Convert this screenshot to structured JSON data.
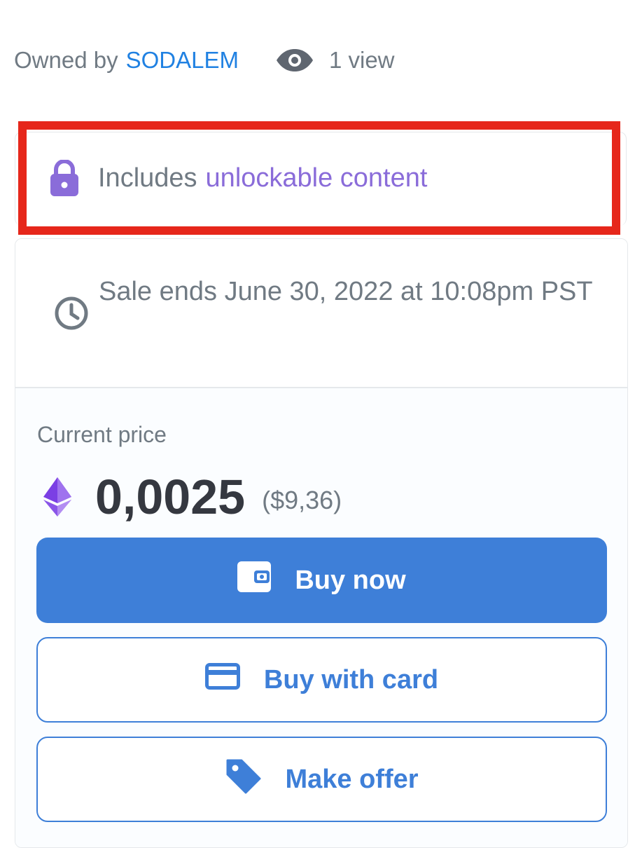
{
  "owner": {
    "prefix": "Owned by",
    "name": "SODALEM",
    "views": "1 view"
  },
  "unlockable": {
    "prefix": "Includes",
    "link": "unlockable content"
  },
  "sale": {
    "ends_text": "Sale ends June 30, 2022 at 10:08pm PST"
  },
  "price": {
    "label": "Current price",
    "value": "0,0025",
    "usd": "($9,36)"
  },
  "buttons": {
    "buy_now": "Buy now",
    "buy_with_card": "Buy with card",
    "make_offer": "Make offer"
  },
  "icons": {
    "eye": "eye-icon",
    "lock": "lock-icon",
    "clock": "clock-icon",
    "eth": "ethereum-icon",
    "wallet": "wallet-icon",
    "card": "credit-card-icon",
    "tag": "tag-icon"
  },
  "colors": {
    "accent": "#3e7fd8",
    "link": "#2081e2",
    "purple": "#8a6cd9",
    "highlight": "#e6271b",
    "text_muted": "#707a83",
    "text_dark": "#353840"
  }
}
